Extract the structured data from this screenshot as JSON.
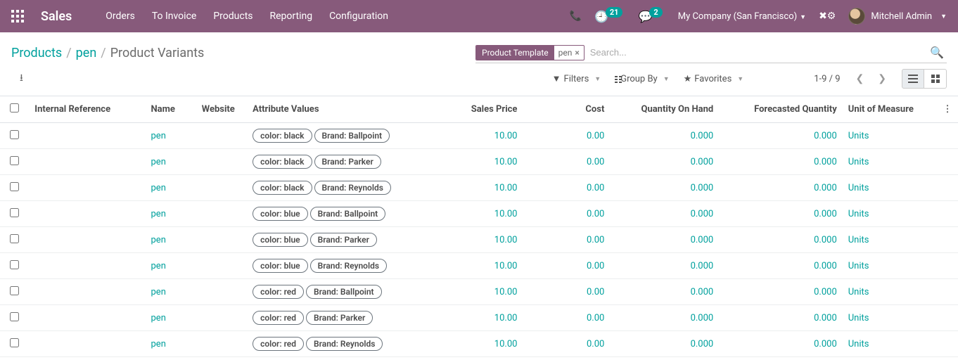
{
  "topbar": {
    "brand": "Sales",
    "nav": [
      "Orders",
      "To Invoice",
      "Products",
      "Reporting",
      "Configuration"
    ],
    "clock_badge": "21",
    "chat_badge": "2",
    "company": "My Company (San Francisco)",
    "user": "Mitchell Admin"
  },
  "breadcrumb": {
    "a": "Products",
    "b": "pen",
    "c": "Product Variants"
  },
  "search": {
    "facet_label": "Product Template",
    "facet_value": "pen",
    "placeholder": "Search..."
  },
  "filterbar": {
    "filters": "Filters",
    "groupby": "Group By",
    "favorites": "Favorites"
  },
  "pager": "1-9 / 9",
  "columns": {
    "ref": "Internal Reference",
    "name": "Name",
    "website": "Website",
    "attrs": "Attribute Values",
    "price": "Sales Price",
    "cost": "Cost",
    "qty": "Quantity On Hand",
    "forecast": "Forecasted Quantity",
    "uom": "Unit of Measure"
  },
  "rows": [
    {
      "name": "pen",
      "attrs": [
        "color: black",
        "Brand: Ballpoint"
      ],
      "price": "10.00",
      "cost": "0.00",
      "qty": "0.000",
      "forecast": "0.000",
      "uom": "Units"
    },
    {
      "name": "pen",
      "attrs": [
        "color: black",
        "Brand: Parker"
      ],
      "price": "10.00",
      "cost": "0.00",
      "qty": "0.000",
      "forecast": "0.000",
      "uom": "Units"
    },
    {
      "name": "pen",
      "attrs": [
        "color: black",
        "Brand: Reynolds"
      ],
      "price": "10.00",
      "cost": "0.00",
      "qty": "0.000",
      "forecast": "0.000",
      "uom": "Units"
    },
    {
      "name": "pen",
      "attrs": [
        "color: blue",
        "Brand: Ballpoint"
      ],
      "price": "10.00",
      "cost": "0.00",
      "qty": "0.000",
      "forecast": "0.000",
      "uom": "Units"
    },
    {
      "name": "pen",
      "attrs": [
        "color: blue",
        "Brand: Parker"
      ],
      "price": "10.00",
      "cost": "0.00",
      "qty": "0.000",
      "forecast": "0.000",
      "uom": "Units"
    },
    {
      "name": "pen",
      "attrs": [
        "color: blue",
        "Brand: Reynolds"
      ],
      "price": "10.00",
      "cost": "0.00",
      "qty": "0.000",
      "forecast": "0.000",
      "uom": "Units"
    },
    {
      "name": "pen",
      "attrs": [
        "color: red",
        "Brand: Ballpoint"
      ],
      "price": "10.00",
      "cost": "0.00",
      "qty": "0.000",
      "forecast": "0.000",
      "uom": "Units"
    },
    {
      "name": "pen",
      "attrs": [
        "color: red",
        "Brand: Parker"
      ],
      "price": "10.00",
      "cost": "0.00",
      "qty": "0.000",
      "forecast": "0.000",
      "uom": "Units"
    },
    {
      "name": "pen",
      "attrs": [
        "color: red",
        "Brand: Reynolds"
      ],
      "price": "10.00",
      "cost": "0.00",
      "qty": "0.000",
      "forecast": "0.000",
      "uom": "Units"
    }
  ]
}
